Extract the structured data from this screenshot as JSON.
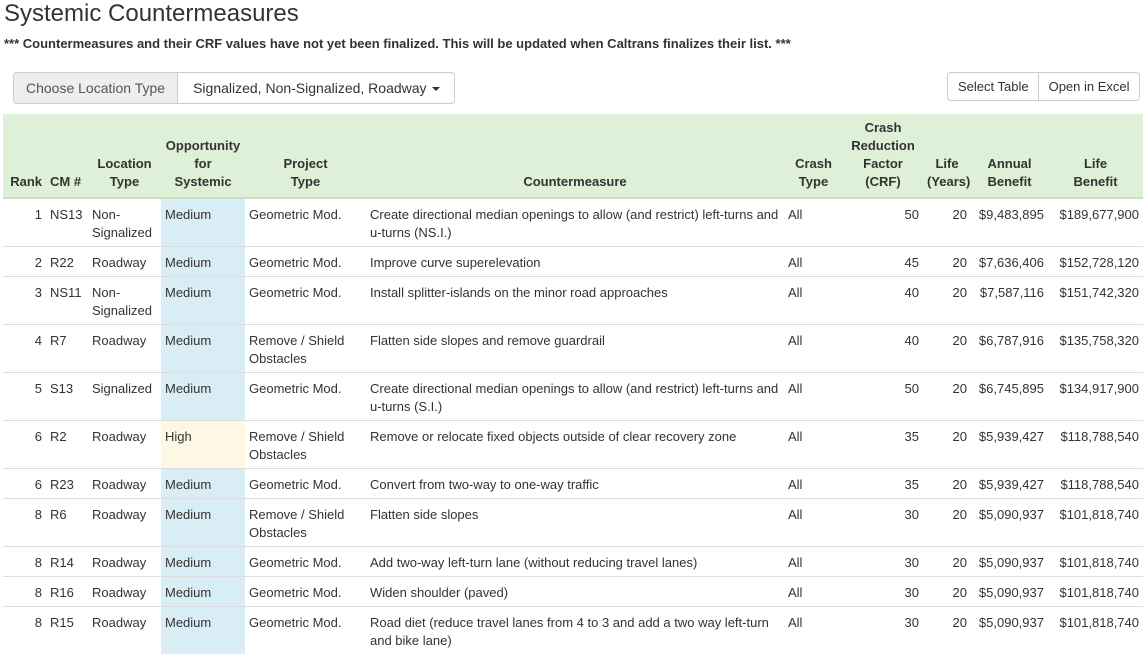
{
  "page": {
    "title": "Systemic Countermeasures",
    "notice": "*** Countermeasures and their CRF values have not yet been finalized. This will be updated when Caltrans finalizes their list. ***"
  },
  "filter": {
    "label": "Choose Location Type",
    "value": "Signalized, Non-Signalized, Roadway"
  },
  "toolbar": {
    "select_table": "Select Table",
    "open_excel": "Open in Excel"
  },
  "colors": {
    "header_bg": "#dff0d8",
    "medium_bg": "#d9edf7",
    "high_bg": "#fcf8e3"
  },
  "table": {
    "headers": {
      "rank": "Rank",
      "cm": "CM #",
      "location_l1": "Location",
      "location_l2": "Type",
      "opp_l1": "Opportunity",
      "opp_l2": "for",
      "opp_l3": "Systemic",
      "project_l1": "Project",
      "project_l2": "Type",
      "countermeasure": "Countermeasure",
      "crash_l1": "Crash",
      "crash_l2": "Type",
      "crf_l1": "Crash",
      "crf_l2": "Reduction",
      "crf_l3": "Factor",
      "crf_l4": "(CRF)",
      "life_l1": "Life",
      "life_l2": "(Years)",
      "annual_l1": "Annual",
      "annual_l2": "Benefit",
      "lifeben_l1": "Life",
      "lifeben_l2": "Benefit"
    },
    "rows": [
      {
        "rank": "1",
        "cm": "NS13",
        "location": "Non-Signalized",
        "opportunity": "Medium",
        "project": "Geometric Mod.",
        "countermeasure": "Create directional median openings to allow (and restrict) left-turns and u-turns (NS.I.)",
        "crash": "All",
        "crf": "50",
        "life": "20",
        "annual": "$9,483,895",
        "life_benefit": "$189,677,900"
      },
      {
        "rank": "2",
        "cm": "R22",
        "location": "Roadway",
        "opportunity": "Medium",
        "project": "Geometric Mod.",
        "countermeasure": "Improve curve superelevation",
        "crash": "All",
        "crf": "45",
        "life": "20",
        "annual": "$7,636,406",
        "life_benefit": "$152,728,120"
      },
      {
        "rank": "3",
        "cm": "NS11",
        "location": "Non-Signalized",
        "opportunity": "Medium",
        "project": "Geometric Mod.",
        "countermeasure": "Install splitter-islands on the minor road approaches",
        "crash": "All",
        "crf": "40",
        "life": "20",
        "annual": "$7,587,116",
        "life_benefit": "$151,742,320"
      },
      {
        "rank": "4",
        "cm": "R7",
        "location": "Roadway",
        "opportunity": "Medium",
        "project": "Remove / Shield Obstacles",
        "countermeasure": "Flatten side slopes and remove guardrail",
        "crash": "All",
        "crf": "40",
        "life": "20",
        "annual": "$6,787,916",
        "life_benefit": "$135,758,320"
      },
      {
        "rank": "5",
        "cm": "S13",
        "location": "Signalized",
        "opportunity": "Medium",
        "project": "Geometric Mod.",
        "countermeasure": "Create directional median openings to allow (and restrict) left-turns and u-turns (S.I.)",
        "crash": "All",
        "crf": "50",
        "life": "20",
        "annual": "$6,745,895",
        "life_benefit": "$134,917,900"
      },
      {
        "rank": "6",
        "cm": "R2",
        "location": "Roadway",
        "opportunity": "High",
        "project": "Remove / Shield Obstacles",
        "countermeasure": "Remove or relocate fixed objects outside of clear recovery zone",
        "crash": "All",
        "crf": "35",
        "life": "20",
        "annual": "$5,939,427",
        "life_benefit": "$118,788,540"
      },
      {
        "rank": "6",
        "cm": "R23",
        "location": "Roadway",
        "opportunity": "Medium",
        "project": "Geometric Mod.",
        "countermeasure": "Convert from two-way to one-way traffic",
        "crash": "All",
        "crf": "35",
        "life": "20",
        "annual": "$5,939,427",
        "life_benefit": "$118,788,540"
      },
      {
        "rank": "8",
        "cm": "R6",
        "location": "Roadway",
        "opportunity": "Medium",
        "project": "Remove / Shield Obstacles",
        "countermeasure": "Flatten side slopes",
        "crash": "All",
        "crf": "30",
        "life": "20",
        "annual": "$5,090,937",
        "life_benefit": "$101,818,740"
      },
      {
        "rank": "8",
        "cm": "R14",
        "location": "Roadway",
        "opportunity": "Medium",
        "project": "Geometric Mod.",
        "countermeasure": "Add two-way left-turn lane (without reducing travel lanes)",
        "crash": "All",
        "crf": "30",
        "life": "20",
        "annual": "$5,090,937",
        "life_benefit": "$101,818,740"
      },
      {
        "rank": "8",
        "cm": "R16",
        "location": "Roadway",
        "opportunity": "Medium",
        "project": "Geometric Mod.",
        "countermeasure": "Widen shoulder (paved)",
        "crash": "All",
        "crf": "30",
        "life": "20",
        "annual": "$5,090,937",
        "life_benefit": "$101,818,740"
      },
      {
        "rank": "8",
        "cm": "R15",
        "location": "Roadway",
        "opportunity": "Medium",
        "project": "Geometric Mod.",
        "countermeasure": "Road diet (reduce travel lanes from 4 to 3 and add a two way left-turn and bike lane)",
        "crash": "All",
        "crf": "30",
        "life": "20",
        "annual": "$5,090,937",
        "life_benefit": "$101,818,740"
      }
    ]
  }
}
